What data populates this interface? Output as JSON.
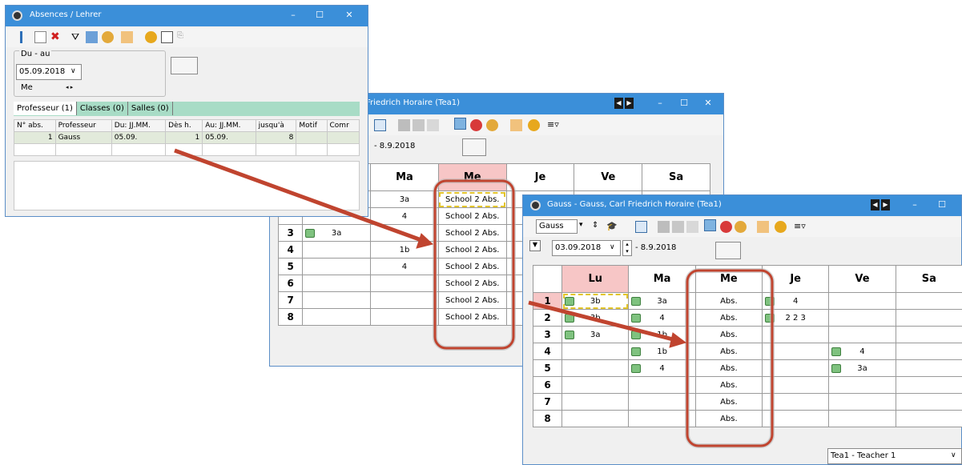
{
  "colors": {
    "title_bar": "#3b8fd9",
    "accent_pink": "#f7c6c6",
    "arrow": "#c0442f",
    "highlight_yellow": "#ffff00",
    "tab_green": "#a8dcc6"
  },
  "absences_window": {
    "title": "Absences / Lehrer",
    "range_label": "Du - au",
    "date_value": "05.09.2018",
    "weekday": "Me",
    "tabs": [
      "Professeur (1)",
      "Classes (0)",
      "Salles (0)"
    ],
    "columns": [
      "N° abs.",
      "Professeur",
      "Du: JJ.MM.",
      "Dès h.",
      "Au: JJ.MM.",
      "jusqu'à",
      "Motif",
      "Comr"
    ],
    "row": [
      "1",
      "Gauss",
      "05.09.",
      "1",
      "05.09.",
      "8",
      "",
      ""
    ]
  },
  "middle_window": {
    "title": "Friedrich  Horaire  (Tea1)",
    "date_range": "- 8.9.2018",
    "days": [
      "Ma",
      "Me",
      "Je",
      "Ve",
      "Sa"
    ],
    "rows": [
      {
        "n": "",
        "ma": "3a",
        "me": "School 2 Abs."
      },
      {
        "n": "",
        "ma": "4",
        "me": "School 2 Abs."
      },
      {
        "n": "3",
        "lu": "3a",
        "ma": "",
        "me": "School 2 Abs."
      },
      {
        "n": "4",
        "ma": "1b",
        "me": "School 2 Abs."
      },
      {
        "n": "5",
        "ma": "4",
        "me": "School 2 Abs."
      },
      {
        "n": "6",
        "ma": "",
        "me": "School 2 Abs."
      },
      {
        "n": "7",
        "ma": "",
        "me": "School 2 Abs."
      },
      {
        "n": "8",
        "ma": "",
        "me": "School 2 Abs."
      }
    ]
  },
  "right_window": {
    "title": "Gauss - Gauss, Carl Friedrich  Horaire  (Tea1)",
    "teacher_select": "Gauss",
    "date_value": "03.09.2018",
    "date_range": "- 8.9.2018",
    "days": [
      "Lu",
      "Ma",
      "Me",
      "Je",
      "Ve",
      "Sa"
    ],
    "rows": [
      {
        "n": "1",
        "lu": "3b",
        "ma": "3a",
        "me": "Abs.",
        "je": "4",
        "ve": ""
      },
      {
        "n": "2",
        "lu": "3b",
        "ma": "4",
        "me": "Abs.",
        "je": "2 2 3",
        "ve": ""
      },
      {
        "n": "3",
        "lu": "3a",
        "ma": "1b",
        "me": "Abs.",
        "je": "",
        "ve": ""
      },
      {
        "n": "4",
        "lu": "",
        "ma": "1b",
        "me": "Abs.",
        "je": "",
        "ve": "4"
      },
      {
        "n": "5",
        "lu": "",
        "ma": "4",
        "me": "Abs.",
        "je": "",
        "ve": "3a"
      },
      {
        "n": "6",
        "lu": "",
        "ma": "",
        "me": "Abs.",
        "je": "",
        "ve": ""
      },
      {
        "n": "7",
        "lu": "",
        "ma": "",
        "me": "Abs.",
        "je": "",
        "ve": ""
      },
      {
        "n": "8",
        "lu": "",
        "ma": "",
        "me": "Abs.",
        "je": "",
        "ve": ""
      }
    ],
    "footer_select": "Tea1 - Teacher 1"
  }
}
